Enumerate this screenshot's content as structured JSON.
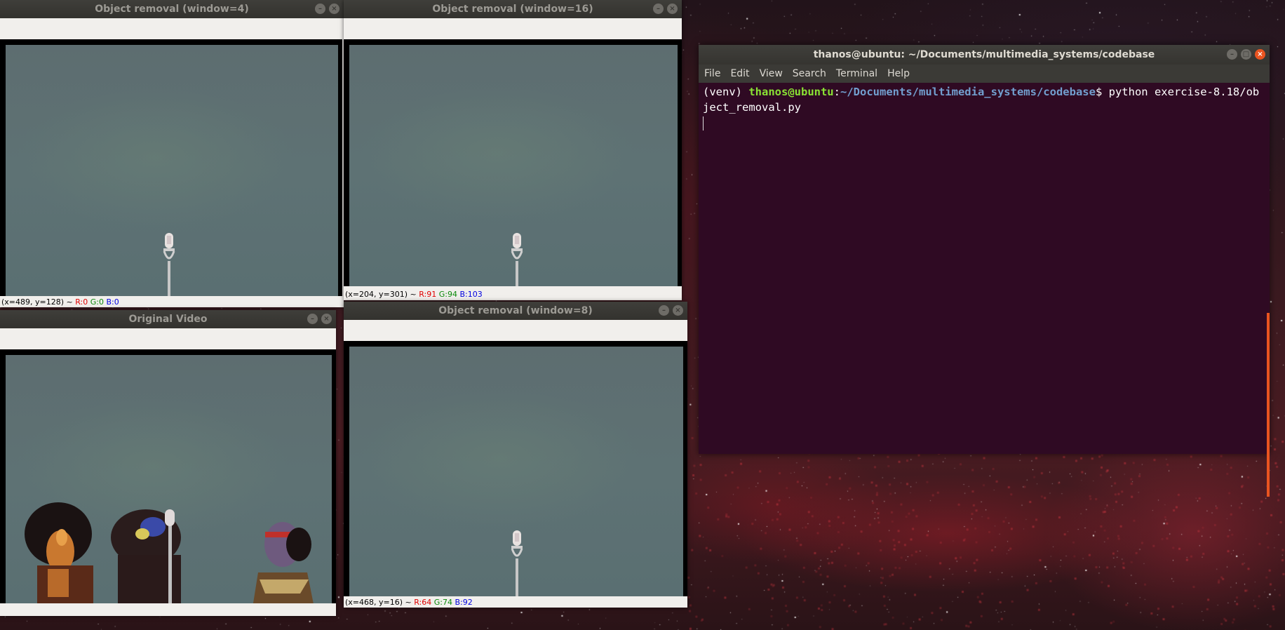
{
  "windows": {
    "w4": {
      "title": "Object removal (window=4)",
      "status": {
        "coords": "(x=489, y=128) ~ ",
        "r": "R:0",
        "g": "G:0",
        "b": "B:0"
      }
    },
    "w16": {
      "title": "Object removal (window=16)",
      "status": {
        "coords": "(x=204, y=301) ~ ",
        "r": "R:91",
        "g": "G:94",
        "b": "B:103"
      }
    },
    "orig": {
      "title": "Original Video"
    },
    "w8": {
      "title": "Object removal (window=8)",
      "status": {
        "coords": "(x=468, y=16) ~ ",
        "r": "R:64",
        "g": "G:74",
        "b": "B:92"
      }
    }
  },
  "terminal": {
    "title": "thanos@ubuntu: ~/Documents/multimedia_systems/codebase",
    "menu": [
      "File",
      "Edit",
      "View",
      "Search",
      "Terminal",
      "Help"
    ],
    "venv": "(venv) ",
    "user": "thanos@ubuntu",
    "colon": ":",
    "path": "~/Documents/multimedia_systems/codebase",
    "dollar": "$ ",
    "command": "python exercise-8.18/object_removal.py"
  },
  "icons": {
    "minimize": "minimize-icon",
    "close": "close-icon",
    "maximize": "maximize-icon"
  },
  "colors": {
    "terminal_bg": "#300a24",
    "prompt_user": "#8ae234",
    "prompt_path": "#729fcf",
    "ubuntu_orange": "#e95420"
  }
}
